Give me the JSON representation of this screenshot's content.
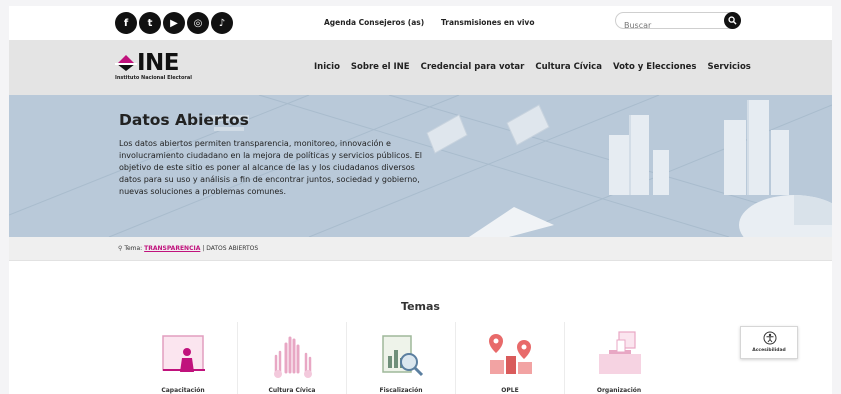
{
  "topbar": {
    "social": [
      {
        "icon": "facebook-icon",
        "glyph": "f"
      },
      {
        "icon": "twitter-icon",
        "glyph": "t"
      },
      {
        "icon": "youtube-icon",
        "glyph": "▶"
      },
      {
        "icon": "instagram-icon",
        "glyph": "◎"
      },
      {
        "icon": "tiktok-icon",
        "glyph": "♪"
      }
    ],
    "links": [
      "Agenda Consejeros (as)",
      "Transmisiones en vivo"
    ],
    "search_placeholder": "Buscar"
  },
  "nav": {
    "logo_text": "INE",
    "logo_subtitle": "Instituto Nacional Electoral",
    "items": [
      "Inicio",
      "Sobre el INE",
      "Credencial para votar",
      "Cultura Cívica",
      "Voto y Elecciones",
      "Servicios"
    ]
  },
  "hero": {
    "title": "Datos Abiertos",
    "description": "Los datos abiertos permiten transparencia, monitoreo, innovación e involucramiento ciudadano en la mejora de políticas y servicios públicos. El objetivo de este sitio es poner al alcance de las y los ciudadanos diversos datos para su uso y análisis a fin de encontrar juntos, sociedad y gobierno, nuevas soluciones a problemas comunes."
  },
  "breadcrumb": {
    "prefix": "Tema:",
    "link": "TRANSPARENCIA",
    "separator": "|",
    "current": "DATOS ABIERTOS"
  },
  "temas": {
    "title": "Temas",
    "items": [
      {
        "label": "Capacitación",
        "icon": "training-icon"
      },
      {
        "label": "Cultura Cívica",
        "icon": "raised-hands-icon"
      },
      {
        "label": "Fiscalización",
        "icon": "chart-magnifier-icon"
      },
      {
        "label": "OPLE",
        "icon": "map-pins-icon"
      },
      {
        "label": "Organización",
        "icon": "ballot-box-icon"
      }
    ]
  },
  "accessibility": {
    "label": "Accesibilidad"
  },
  "colors": {
    "accent": "#c0127c",
    "hero_bg": "#b9c9d9",
    "nav_bg": "#e4e4e4",
    "icon_pink": "#e8a7c4"
  }
}
